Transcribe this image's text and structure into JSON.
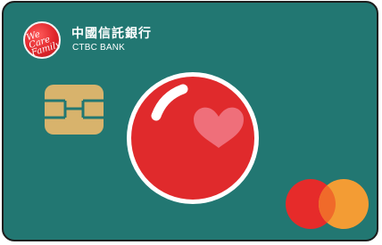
{
  "card": {
    "bank_name": "中國信託銀行",
    "bank_name_en": "CTBC BANK",
    "logo_text": "We\nCare\nFamily",
    "colors": {
      "card_background": "#227772",
      "ball_red": "#e02a2c",
      "heart_pink": "#ef6f7a",
      "mastercard_red": "#e62b2a",
      "mastercard_orange": "#f39c34",
      "chip_gold": "#d8b36c"
    },
    "icons": [
      "we-care-family-logo-icon",
      "emv-chip-icon",
      "red-ball-heart-icon",
      "mastercard-logo-icon"
    ]
  }
}
